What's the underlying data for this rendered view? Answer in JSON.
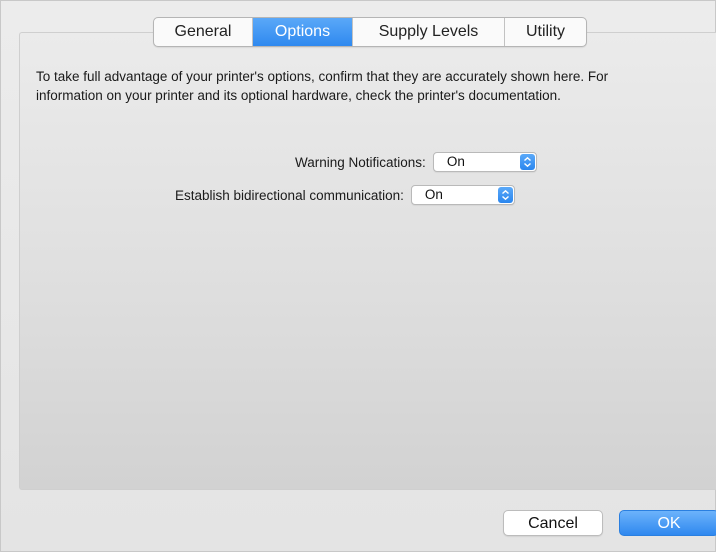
{
  "tabs": [
    {
      "label": "General",
      "active": false
    },
    {
      "label": "Options",
      "active": true
    },
    {
      "label": "Supply Levels",
      "active": false
    },
    {
      "label": "Utility",
      "active": false
    }
  ],
  "description": "To take full advantage of your printer's options, confirm that they are accurately shown here. For information on your printer and its optional hardware, check the printer's documentation.",
  "options": [
    {
      "label": "Warning Notifications:",
      "value": "On"
    },
    {
      "label": "Establish bidirectional communication:",
      "value": "On"
    }
  ],
  "buttons": {
    "cancel": "Cancel",
    "ok": "OK"
  },
  "colors": {
    "accent": "#3b92f2",
    "background": "#e6e6e6"
  },
  "icons": {
    "select_stepper": "up-down-chevron-icon"
  }
}
